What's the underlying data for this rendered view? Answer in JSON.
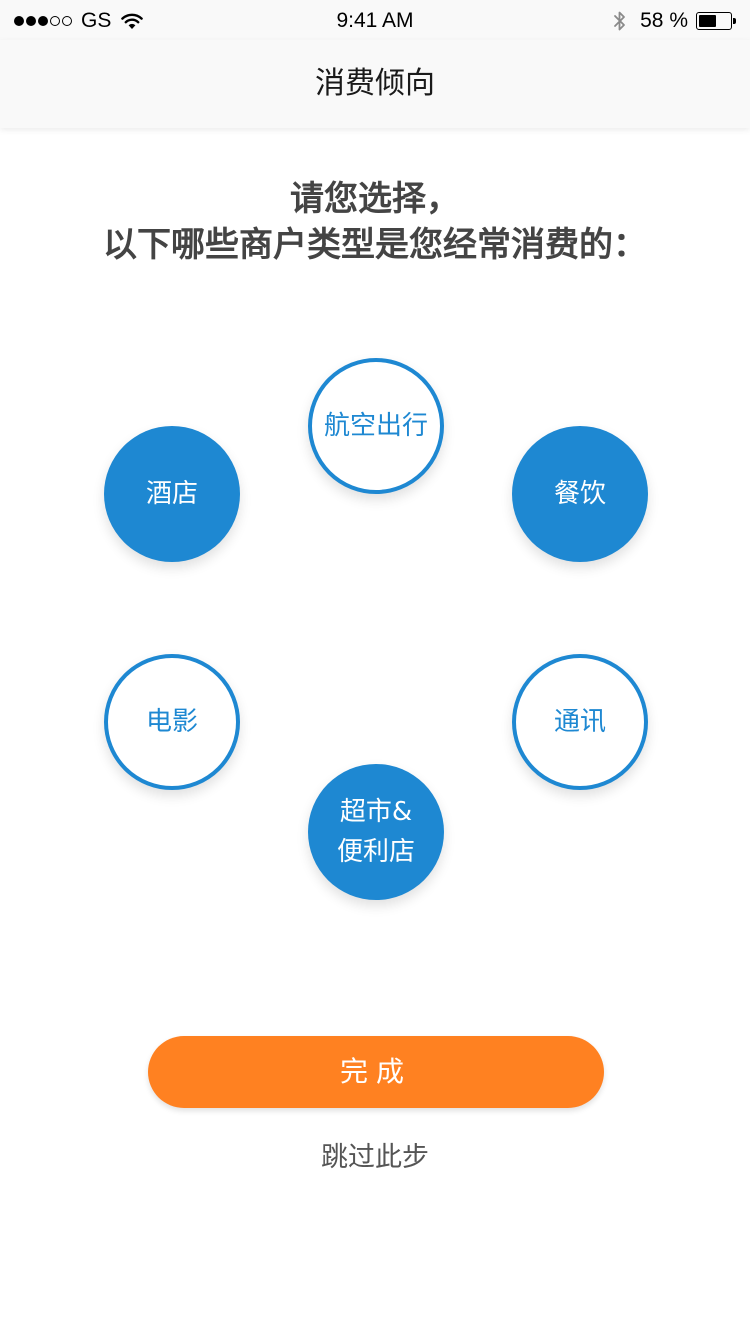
{
  "status_bar": {
    "signal_full": 3,
    "signal_empty": 2,
    "carrier": "GS",
    "time": "9:41 AM",
    "battery_text": "58 %",
    "battery_level": 0.58,
    "icons": [
      "wifi-icon",
      "bluetooth-icon",
      "battery-icon"
    ]
  },
  "nav": {
    "title": "消费倾向"
  },
  "prompt": {
    "line1": "请您选择，",
    "line2": "以下哪些商户类型是您经常消费的："
  },
  "categories": [
    {
      "label": "航空出行",
      "selected": false
    },
    {
      "label": "酒店",
      "selected": true
    },
    {
      "label": "餐饮",
      "selected": true
    },
    {
      "label": "电影",
      "selected": false
    },
    {
      "label": "通讯",
      "selected": false
    },
    {
      "label": "超市&便利店",
      "selected": true
    }
  ],
  "actions": {
    "done_label": "完成",
    "skip_label": "跳过此步"
  },
  "colors": {
    "accent_blue": "#1e88d2",
    "button_orange": "#ff8121",
    "prompt_text": "#444444"
  }
}
